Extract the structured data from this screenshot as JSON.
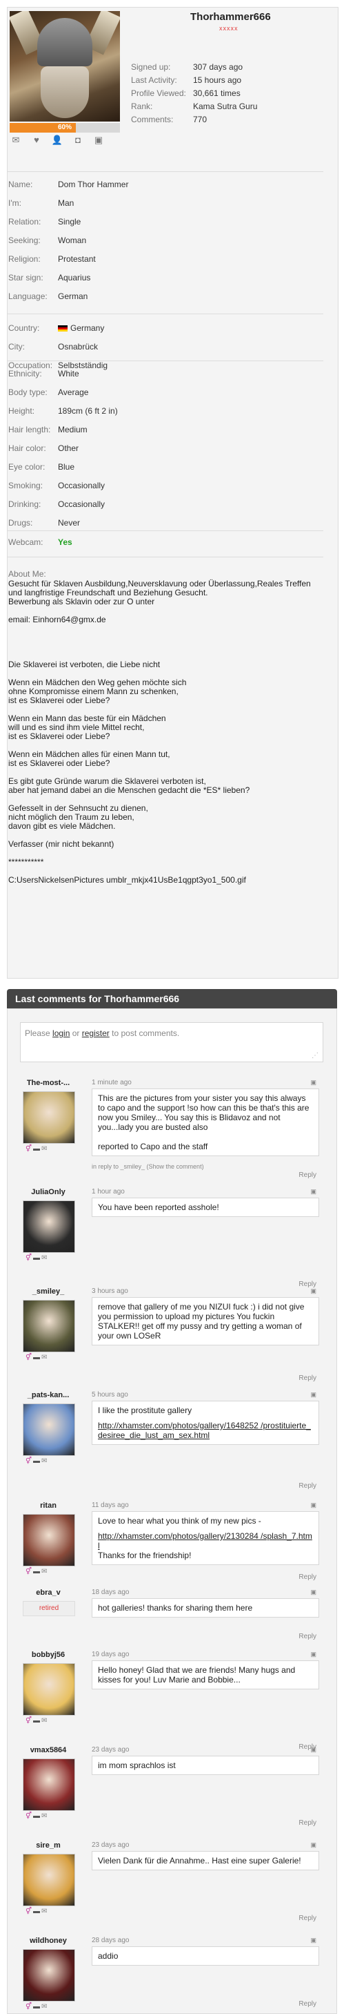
{
  "profile": {
    "username": "Thorhammer666",
    "stars": "xxxxx",
    "completion": "60%",
    "completion_value": 0.6,
    "icons": [
      "mail-icon",
      "heart-icon",
      "add-friend-icon",
      "camera-icon",
      "gift-icon"
    ],
    "stats": [
      {
        "label": "Signed up:",
        "value": "307 days ago"
      },
      {
        "label": "Last Activity:",
        "value": "15 hours ago"
      },
      {
        "label": "Profile Viewed:",
        "value": "30,661 times"
      },
      {
        "label": "Rank:",
        "value": "Kama Sutra Guru"
      },
      {
        "label": "Comments:",
        "value": "770"
      }
    ],
    "details1": [
      {
        "label": "Name:",
        "value": "Dom Thor Hammer"
      },
      {
        "label": "I'm:",
        "value": "Man"
      },
      {
        "label": "Relation:",
        "value": "Single"
      },
      {
        "label": "Seeking:",
        "value": "Woman"
      },
      {
        "label": "Religion:",
        "value": "Protestant"
      },
      {
        "label": "Star sign:",
        "value": "Aquarius"
      },
      {
        "label": "Language:",
        "value": "German"
      }
    ],
    "details2": [
      {
        "label": "Country:",
        "value": "Germany"
      },
      {
        "label": "City:",
        "value": "Osnabrück"
      },
      {
        "label": "Occupation:",
        "value": "Selbstständig"
      }
    ],
    "details3": [
      {
        "label": "Ethnicity:",
        "value": "White"
      },
      {
        "label": "Body type:",
        "value": "Average"
      },
      {
        "label": "Height:",
        "value": "189cm (6 ft 2 in)"
      },
      {
        "label": "Hair length:",
        "value": "Medium"
      },
      {
        "label": "Hair color:",
        "value": "Other"
      },
      {
        "label": "Eye color:",
        "value": "Blue"
      },
      {
        "label": "Smoking:",
        "value": "Occasionally"
      },
      {
        "label": "Drinking:",
        "value": "Occasionally"
      },
      {
        "label": "Drugs:",
        "value": "Never"
      }
    ],
    "webcam_label": "Webcam:",
    "webcam_value": "Yes",
    "about_label": "About Me:",
    "about_text": "Gesucht für Sklaven Ausbildung,Neuversklavung oder Überlassung,Reales Treffen und langfristige Freundschaft und Beziehung Gesucht.\nBewerbung als Sklavin oder zur O unter\n\nemail: Einhorn64@gmx.de\n\n\n\n\nDie Sklaverei ist verboten, die Liebe nicht\n\nWenn ein Mädchen den Weg gehen möchte sich\nohne Kompromisse einem Mann zu schenken,\nist es Sklaverei oder Liebe?\n\nWenn ein Mann das beste für ein Mädchen\nwill und es sind ihm viele Mittel recht,\nist es Sklaverei oder Liebe?\n\nWenn ein Mädchen alles für einen Mann tut,\nist es Sklaverei oder Liebe?\n\nEs gibt gute Gründe warum die Sklaverei verboten ist,\naber hat jemand dabei an die Menschen gedacht die *ES* lieben?\n\nGefesselt in der Sehnsucht zu dienen,\nnicht möglich den Traum zu leben,\ndavon gibt es viele Mädchen.\n\nVerfasser (mir nicht bekannt)\n\n***********\n\nC:UsersNickelsenPictures umblr_mkjx41UsBe1qgpt3yo1_500.gif"
  },
  "comments_section": {
    "title": "Last comments for Thorhammer666",
    "login_please": "Please",
    "login_link": "login",
    "login_or": "or",
    "register_link": "register",
    "login_suffix": "to post comments.",
    "reply_label": "Reply",
    "comments": [
      {
        "user": "The-most-...",
        "time": "1 minute ago",
        "text": "This are the pictures from your sister you say this always to capo and the support !so how can this be that's this are now you Smiley... You say this is Blidavoz and not you...lady you are busted also\n\nreported to Capo and the staff",
        "in_reply": "in reply to _smiley_ (Show the comment)",
        "avatar_color": "#c8b070"
      },
      {
        "user": "JuliaOnly",
        "time": "1 hour ago",
        "text": "You have been reported asshole!",
        "in_reply": "",
        "avatar_color": "#2a2a2a"
      },
      {
        "user": "_smiley_",
        "time": "3 hours ago",
        "text": "remove that gallery of me you NIZUI fuck :) i did not give you permission to upload my pictures You fuckin STALKER!! get off my pussy and try getting a woman of your own LOSeR",
        "in_reply": "",
        "avatar_color": "#5a5a3a"
      },
      {
        "user": "_pats-kan...",
        "time": "5 hours ago",
        "text": "I like the prostitute gallery",
        "link": "http://xhamster.com/photos/gallery/1648252 /prostituierte_desiree_die_lust_am_sex.html",
        "in_reply": "",
        "avatar_color": "#6a8fc8"
      },
      {
        "user": "ritan",
        "time": "11 days ago",
        "text": "Love to hear what you think of my new pics -",
        "link": "http://xhamster.com/photos/gallery/2130284 /splash_7.html",
        "text2": "Thanks for the friendship!",
        "in_reply": "",
        "avatar_color": "#8a4a3a"
      },
      {
        "user": "ebra_v",
        "time": "18 days ago",
        "text": "hot galleries! thanks for sharing them here",
        "retired": "retired",
        "in_reply": "",
        "avatar_color": "#eeeeee"
      },
      {
        "user": "bobbyj56",
        "time": "19 days ago",
        "text": "Hello honey! Glad that we are friends! Many hugs and kisses for you! Luv Marie and Bobbie...",
        "in_reply": "",
        "avatar_color": "#e8c060"
      },
      {
        "user": "vmax5864",
        "time": "23 days ago",
        "text": "im mom sprachlos ist",
        "in_reply": "",
        "avatar_color": "#8a2a2a"
      },
      {
        "user": "sire_m",
        "time": "23 days ago",
        "text": "Vielen Dank für die Annahme.. Hast eine super Galerie!",
        "in_reply": "",
        "avatar_color": "#d8a040"
      },
      {
        "user": "wildhoney",
        "time": "28 days ago",
        "text": "addio",
        "in_reply": "",
        "avatar_color": "#5a1a1a"
      }
    ]
  }
}
